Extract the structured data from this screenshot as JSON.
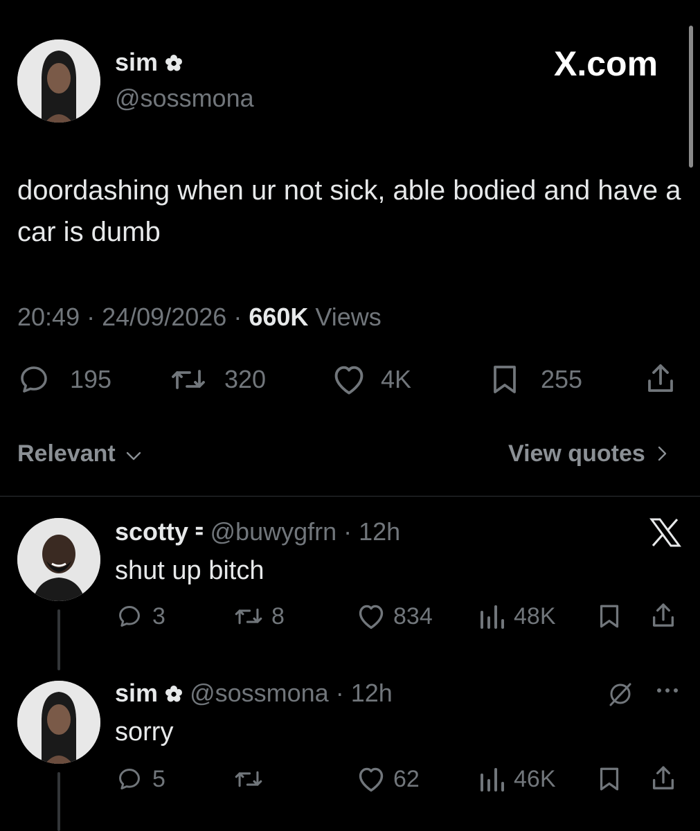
{
  "brand": {
    "watermark": "X.com",
    "accent": "#1d9bf0",
    "text": "#e7e9ea",
    "muted": "#71767b",
    "background": "#000000"
  },
  "main_post": {
    "author": {
      "name": "sim",
      "handle": "@sossmona",
      "badge": "flower-icon"
    },
    "text": "doordashing when ur not sick, able bodied and have a car is dumb",
    "time": "20:49",
    "date": "24/09/2026",
    "views_count": "660K",
    "views_label": "Views",
    "stats": {
      "replies": "195",
      "reposts": "320",
      "likes": "4K",
      "bookmarks": "255"
    }
  },
  "reply_controls": {
    "sort_label": "Relevant",
    "quotes_label": "View quotes"
  },
  "replies": [
    {
      "name": "scotty",
      "badge_char": "⹀",
      "handle": "@buwygfrn",
      "time": "12h",
      "text": "shut up bitch",
      "stats": {
        "replies": "3",
        "reposts": "8",
        "likes": "834",
        "views": "48K"
      }
    },
    {
      "name": "sim",
      "handle": "@sossmona",
      "time": "12h",
      "text": "sorry",
      "stats": {
        "replies": "5",
        "reposts": "",
        "likes": "62",
        "views": "46K"
      }
    }
  ]
}
